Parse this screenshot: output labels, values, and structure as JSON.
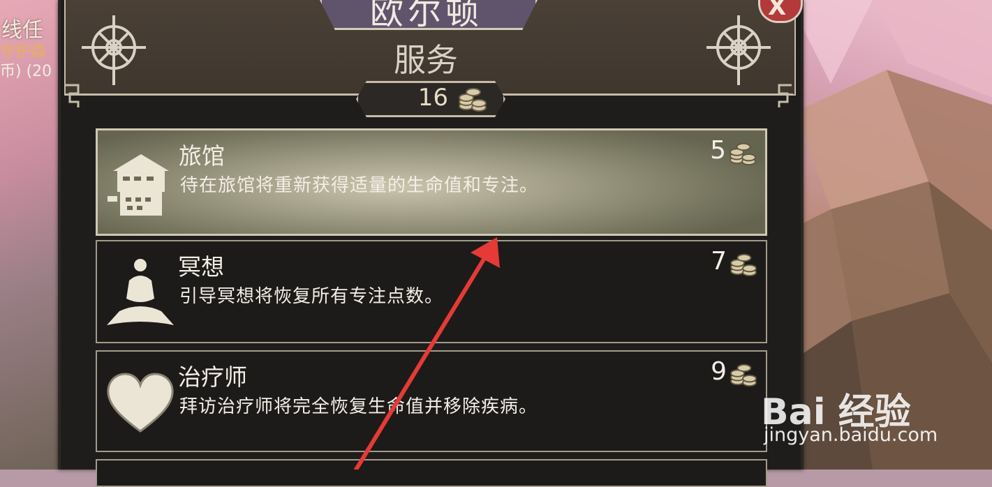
{
  "background_left": {
    "quest_line_1": "线任",
    "quest_line_2": "守护森",
    "quest_line_3": "币) (20"
  },
  "panel": {
    "title": "欧尔顿",
    "subtitle": "服务",
    "coin_balance": "16",
    "close_label": "X"
  },
  "services": [
    {
      "name": "旅馆",
      "description": "待在旅馆将重新获得适量的生命值和专注。",
      "price": "5",
      "icon": "inn-house-icon",
      "selected": true
    },
    {
      "name": "冥想",
      "description": "引导冥想将恢复所有专注点数。",
      "price": "7",
      "icon": "meditation-figure-icon",
      "selected": false
    },
    {
      "name": "治疗师",
      "description": "拜访治疗师将完全恢复生命值并移除疾病。",
      "price": "9",
      "icon": "heart-icon",
      "selected": false
    },
    {
      "name": "",
      "description": "",
      "price": "",
      "icon": "",
      "selected": false
    }
  ],
  "watermark": {
    "logo_text": "Bai 经验",
    "url": "jingyan.baidu.com"
  },
  "colors": {
    "panel_bg": "#1f1d1c",
    "header_bg": "#4a4036",
    "title_plate": "#5f546c",
    "selected_row": "#9d9a83",
    "border": "#c6bca9",
    "arrow": "#e53a35",
    "close_button": "#b3393a"
  }
}
